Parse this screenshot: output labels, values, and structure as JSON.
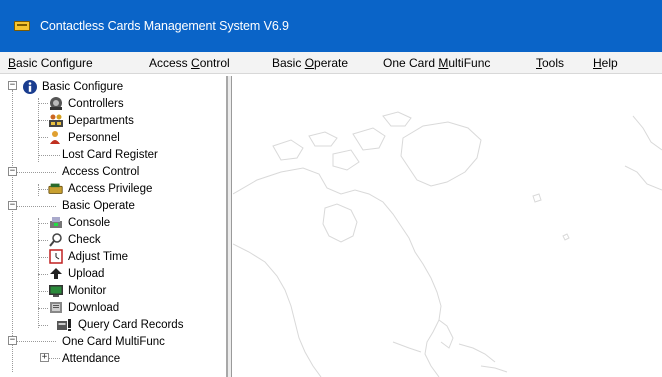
{
  "window": {
    "title": "Contactless Cards Management System  V6.9"
  },
  "menubar": {
    "items": [
      {
        "label_prefix": "",
        "underline": "B",
        "label_rest": "asic Configure"
      },
      {
        "label_prefix": "Access ",
        "underline": "C",
        "label_rest": "ontrol"
      },
      {
        "label_prefix": "Basic ",
        "underline": "O",
        "label_rest": "perate"
      },
      {
        "label_prefix": "One Card ",
        "underline": "M",
        "label_rest": "ultiFunc"
      },
      {
        "label_prefix": "",
        "underline": "T",
        "label_rest": "ools"
      },
      {
        "label_prefix": "",
        "underline": "H",
        "label_rest": "elp"
      }
    ]
  },
  "tree": {
    "basic_configure": {
      "label": "Basic Configure",
      "children": [
        "Controllers",
        "Departments",
        "Personnel",
        "Lost Card Register"
      ]
    },
    "access_control": {
      "label": "Access Control",
      "children": [
        "Access Privilege"
      ]
    },
    "basic_operate": {
      "label": "Basic Operate",
      "children": [
        "Console",
        "Check",
        "Adjust Time",
        "Upload",
        "Monitor",
        "Download",
        "Query Card Records"
      ]
    },
    "one_card": {
      "label": "One Card MultiFunc",
      "children": [
        "Attendance"
      ]
    },
    "expander_collapse": "−",
    "expander_expand": "+"
  },
  "icons": {
    "app": "cards-icon",
    "info": "info-icon",
    "controllers": "controller-icon",
    "departments": "departments-icon",
    "personnel": "person-icon",
    "access_privilege": "card-reader-icon",
    "console": "console-icon",
    "check": "check-icon",
    "adjust_time": "clock-icon",
    "upload": "upload-icon",
    "monitor": "monitor-icon",
    "download": "download-icon",
    "query": "query-records-icon"
  },
  "colors": {
    "titlebar": "#0a64c8",
    "menubar": "#f3f3f3",
    "map_outline": "#d9d9d9"
  }
}
